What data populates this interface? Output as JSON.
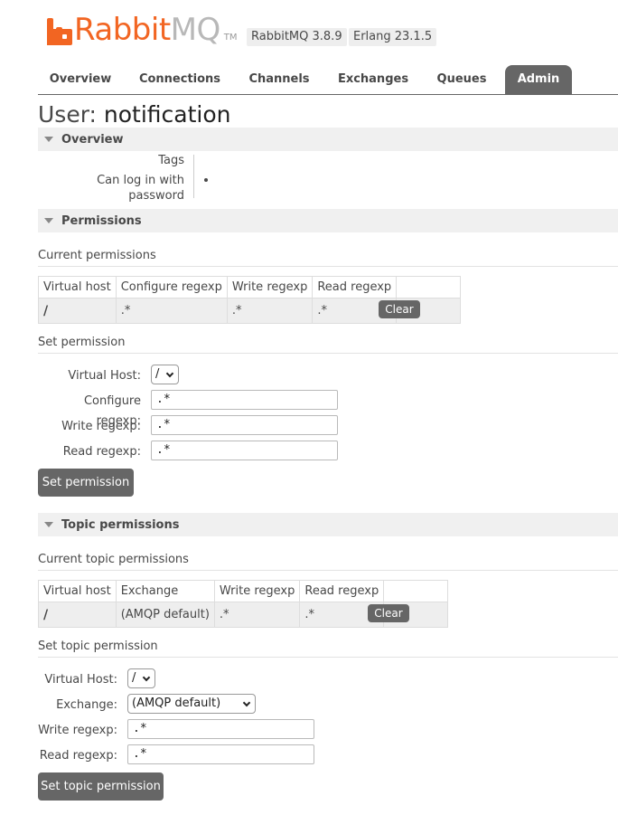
{
  "header": {
    "logo_brand": "Rabbit",
    "logo_mq": "MQ",
    "logo_tm": "TM",
    "version_rabbit": "RabbitMQ 3.8.9",
    "version_erlang": "Erlang 23.1.5"
  },
  "tabs": [
    {
      "label": "Overview",
      "active": false
    },
    {
      "label": "Connections",
      "active": false
    },
    {
      "label": "Channels",
      "active": false
    },
    {
      "label": "Exchanges",
      "active": false
    },
    {
      "label": "Queues",
      "active": false
    },
    {
      "label": "Admin",
      "active": true
    }
  ],
  "page": {
    "title_prefix": "User:",
    "user_name": "notification"
  },
  "overview": {
    "heading": "Overview",
    "tags_label": "Tags",
    "tags_value": "",
    "password_label": "Can log in with password"
  },
  "permissions": {
    "heading": "Permissions",
    "current_heading": "Current permissions",
    "columns": [
      "Virtual host",
      "Configure regexp",
      "Write regexp",
      "Read regexp"
    ],
    "row": {
      "vhost": "/",
      "configure": ".*",
      "write": ".*",
      "read": ".*"
    },
    "clear_label": "Clear",
    "set_heading": "Set permission",
    "form": {
      "vhost_label": "Virtual Host:",
      "vhost_value": "/",
      "configure_label": "Configure regexp:",
      "configure_value": ".*",
      "write_label": "Write regexp:",
      "write_value": ".*",
      "read_label": "Read regexp:",
      "read_value": ".*"
    },
    "submit_label": "Set permission"
  },
  "topic": {
    "heading": "Topic permissions",
    "current_heading": "Current topic permissions",
    "columns": [
      "Virtual host",
      "Exchange",
      "Write regexp",
      "Read regexp"
    ],
    "row": {
      "vhost": "/",
      "exchange": "(AMQP default)",
      "write": ".*",
      "read": ".*"
    },
    "clear_label": "Clear",
    "set_heading": "Set topic permission",
    "form": {
      "vhost_label": "Virtual Host:",
      "vhost_value": "/",
      "exchange_label": "Exchange:",
      "exchange_value": "(AMQP default)",
      "write_label": "Write regexp:",
      "write_value": ".*",
      "read_label": "Read regexp:",
      "read_value": ".*"
    },
    "submit_label": "Set topic permission"
  },
  "colors": {
    "logo_orange": "#f26522",
    "tab_active": "#666666",
    "section_bg": "#f0f0f0"
  }
}
